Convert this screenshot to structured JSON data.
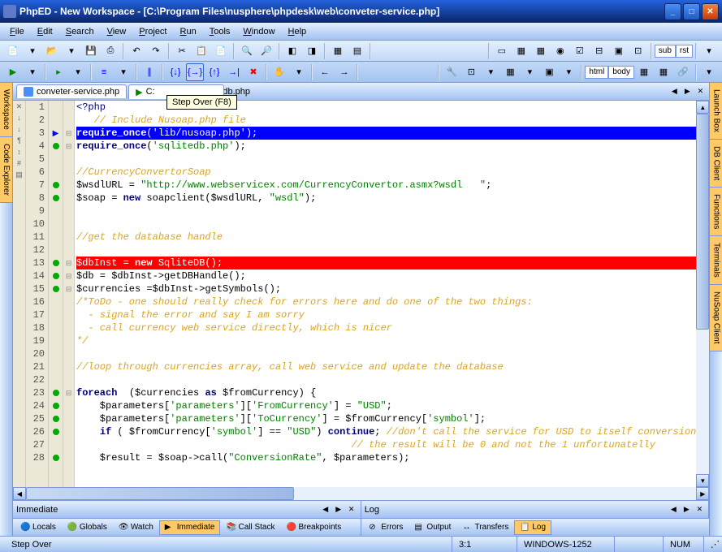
{
  "titlebar": {
    "text": "PhpED - New Workspace - [C:\\Program Files\\nusphere\\phpdesk\\web\\conveter-service.php]"
  },
  "menu": {
    "items": [
      "File",
      "Edit",
      "Search",
      "View",
      "Project",
      "Run",
      "Tools",
      "Window",
      "Help"
    ]
  },
  "tabs": {
    "files": [
      "conveter-service.php",
      "C:",
      "db.php"
    ],
    "tooltip": "Step Over (F8)"
  },
  "left_tabs": [
    "Workspace",
    "Code Explorer"
  ],
  "right_tabs": [
    "Launch Box",
    "DB Client",
    "Functions",
    "Terminals",
    "NuSoap Client"
  ],
  "code": {
    "lines": [
      {
        "n": 1,
        "html": "<span class='navy'>&lt;?php</span>"
      },
      {
        "n": 2,
        "html": "   <span class='cmt'>// Include Nusoap.php file</span>"
      },
      {
        "n": 3,
        "hl": "blue",
        "bp": "arrow",
        "fold": "-",
        "html": "<span style='font-weight:bold'>require_once</span>('lib/nusoap.php');"
      },
      {
        "n": 4,
        "bp": "dot",
        "fold": "-",
        "html": "<span class='kw'>require_once</span>(<span class='str'>'sqlitedb.php'</span>);"
      },
      {
        "n": 5,
        "html": ""
      },
      {
        "n": 6,
        "html": "<span class='cmt'>//CurrencyConvertorSoap</span>"
      },
      {
        "n": 7,
        "bp": "dot",
        "html": "$wsdlURL = <span class='str'>\"http://www.webservicex.com/CurrencyConvertor.asmx?wsdl   \"</span>;"
      },
      {
        "n": 8,
        "bp": "dot",
        "html": "$soap = <span class='kw'>new</span> soapclient($wsdlURL, <span class='str'>\"wsdl\"</span>);"
      },
      {
        "n": 9,
        "html": ""
      },
      {
        "n": 10,
        "html": ""
      },
      {
        "n": 11,
        "html": "<span class='cmt'>//get the database handle</span>"
      },
      {
        "n": 12,
        "html": ""
      },
      {
        "n": 13,
        "hl": "red",
        "bp": "dot",
        "fold": "-",
        "html": "$dbInst = <span style='font-weight:bold'>new</span> SqliteDB();"
      },
      {
        "n": 14,
        "bp": "dot",
        "fold": "-",
        "html": "$db = $dbInst-&gt;getDBHandle();"
      },
      {
        "n": 15,
        "bp": "dot",
        "fold": "-",
        "html": "$currencies =$dbInst-&gt;getSymbols();"
      },
      {
        "n": 16,
        "html": "<span class='cmt'>/*ToDo - one should really check for errors here and do one of the two things:</span>"
      },
      {
        "n": 17,
        "html": "<span class='cmt'>  - signal the error and say I am sorry</span>"
      },
      {
        "n": 18,
        "html": "<span class='cmt'>  - call currency web service directly, which is nicer</span>"
      },
      {
        "n": 19,
        "html": "<span class='cmt'>*/</span>"
      },
      {
        "n": 20,
        "html": ""
      },
      {
        "n": 21,
        "html": "<span class='cmt'>//loop through currencies array, call web service and update the database</span>"
      },
      {
        "n": 22,
        "html": ""
      },
      {
        "n": 23,
        "bp": "dot",
        "fold": "-",
        "html": "<span class='kw'>foreach</span>  ($currencies <span class='kw'>as</span> $fromCurrency) {"
      },
      {
        "n": 24,
        "bp": "dot",
        "html": "    $parameters[<span class='str'>'parameters'</span>][<span class='str'>'FromCurrency'</span>] = <span class='str'>\"USD\"</span>;"
      },
      {
        "n": 25,
        "bp": "dot",
        "html": "    $parameters[<span class='str'>'parameters'</span>][<span class='str'>'ToCurrency'</span>] = $fromCurrency[<span class='str'>'symbol'</span>];"
      },
      {
        "n": 26,
        "bp": "dot",
        "html": "    <span class='kw'>if</span> ( $fromCurrency[<span class='str'>'symbol'</span>] == <span class='str'>\"USD\"</span>) <span class='kw'>continue</span>; <span class='cmt'>//don't call the service for USD to itself conversion</span>"
      },
      {
        "n": 27,
        "html": "                                               <span class='cmt'>// the result will be 0 and not the 1 unfortunatelly</span>"
      },
      {
        "n": 28,
        "bp": "dot",
        "html": "    $result = $soap-&gt;call(<span class='str'>\"ConversionRate\"</span>, $parameters);"
      }
    ]
  },
  "panels": {
    "left": "Immediate",
    "right": "Log"
  },
  "bottom_tabs_left": [
    "Locals",
    "Globals",
    "Watch",
    "Immediate",
    "Call Stack",
    "Breakpoints"
  ],
  "bottom_tabs_right": [
    "Errors",
    "Output",
    "Transfers",
    "Log"
  ],
  "status": {
    "left": "Step Over",
    "cursor": "3:1",
    "encoding": "WINDOWS-1252",
    "mode": "NUM"
  }
}
